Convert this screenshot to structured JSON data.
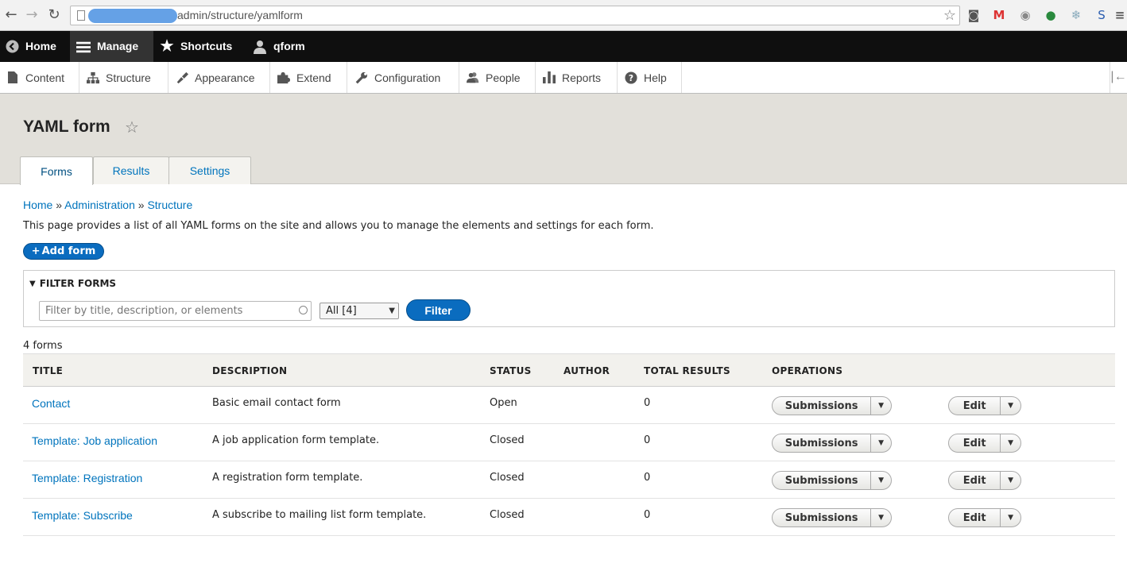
{
  "browser": {
    "url": "admin/structure/yamlform"
  },
  "toolbar": {
    "home": "Home",
    "manage": "Manage",
    "shortcuts": "Shortcuts",
    "user": "qform"
  },
  "tray": {
    "items": [
      "Content",
      "Structure",
      "Appearance",
      "Extend",
      "Configuration",
      "People",
      "Reports",
      "Help"
    ]
  },
  "page": {
    "title": "YAML form",
    "tabs": [
      "Forms",
      "Results",
      "Settings"
    ]
  },
  "breadcrumb": {
    "items": [
      "Home",
      "Administration",
      "Structure"
    ],
    "separator": "»"
  },
  "help_text": "This page provides a list of all YAML forms on the site and allows you to manage the elements and settings for each form.",
  "add_button": "Add form",
  "filter": {
    "legend": "FILTER FORMS",
    "placeholder": "Filter by title, description, or elements",
    "select_value": "All [4]",
    "button": "Filter"
  },
  "count": "4 forms",
  "table": {
    "headers": [
      "TITLE",
      "DESCRIPTION",
      "STATUS",
      "AUTHOR",
      "TOTAL RESULTS",
      "OPERATIONS"
    ],
    "rows": [
      {
        "title": "Contact",
        "description": "Basic email contact form",
        "status": "Open",
        "author": "",
        "total": "0"
      },
      {
        "title": "Template: Job application",
        "description": "A job application form template.",
        "status": "Closed",
        "author": "",
        "total": "0"
      },
      {
        "title": "Template: Registration",
        "description": "A registration form template.",
        "status": "Closed",
        "author": "",
        "total": "0"
      },
      {
        "title": "Template: Subscribe",
        "description": "A subscribe to mailing list form template.",
        "status": "Closed",
        "author": "",
        "total": "0"
      }
    ],
    "ops": {
      "submissions": "Submissions",
      "edit": "Edit"
    }
  },
  "colors": {
    "link": "#0074bd",
    "primary_button": "#0a6cbf",
    "toolbar": "#0f0f0f"
  }
}
